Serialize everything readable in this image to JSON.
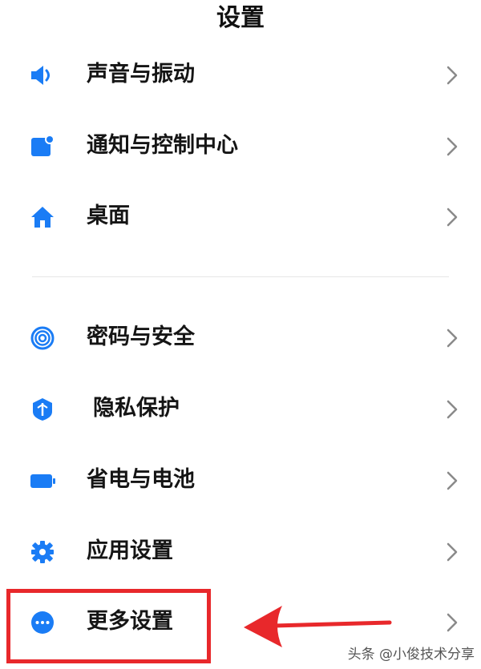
{
  "header": {
    "title": "设置"
  },
  "settings": [
    {
      "label": "声音与振动",
      "icon": "speaker-icon"
    },
    {
      "label": "通知与控制中心",
      "icon": "notification-icon"
    },
    {
      "label": "桌面",
      "icon": "home-icon"
    },
    {
      "label": "密码与安全",
      "icon": "fingerprint-icon"
    },
    {
      "label": "隐私保护",
      "icon": "privacy-shield-icon"
    },
    {
      "label": "省电与电池",
      "icon": "battery-icon"
    },
    {
      "label": "应用设置",
      "icon": "gear-icon"
    },
    {
      "label": "更多设置",
      "icon": "more-dots-icon"
    }
  ],
  "watermark": {
    "text": "头条 @小俊技术分享"
  },
  "colors": {
    "accent": "#1a7cf5",
    "highlight": "#e8282b",
    "divider": "#e6e6e6",
    "chevron": "#8a8a8a"
  }
}
